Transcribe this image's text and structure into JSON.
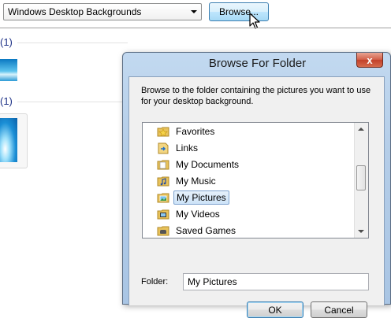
{
  "background_panel": {
    "location_select": "Windows Desktop Backgrounds",
    "browse_button": "Browse...",
    "groups": [
      {
        "count_label": "(1)"
      },
      {
        "count_label": "(1)"
      }
    ]
  },
  "dialog": {
    "title": "Browse For Folder",
    "close_glyph": "x",
    "instructions": "Browse to the folder containing the pictures you want to use for your desktop background.",
    "tree": [
      {
        "label": "Favorites",
        "icon": "favorites-folder-icon",
        "expandable": true
      },
      {
        "label": "Links",
        "icon": "links-folder-icon"
      },
      {
        "label": "My Documents",
        "icon": "documents-folder-icon"
      },
      {
        "label": "My Music",
        "icon": "music-folder-icon"
      },
      {
        "label": "My Pictures",
        "icon": "pictures-folder-icon",
        "selected": true
      },
      {
        "label": "My Videos",
        "icon": "videos-folder-icon"
      },
      {
        "label": "Saved Games",
        "icon": "saved-games-folder-icon"
      }
    ],
    "folder_label": "Folder:",
    "folder_value": "My Pictures",
    "ok_label": "OK",
    "cancel_label": "Cancel"
  },
  "colors": {
    "dialog_frame": "#b4cde8",
    "selection": "#cde3f8",
    "group_header": "#1e3287",
    "close_button": "#c2402a"
  }
}
